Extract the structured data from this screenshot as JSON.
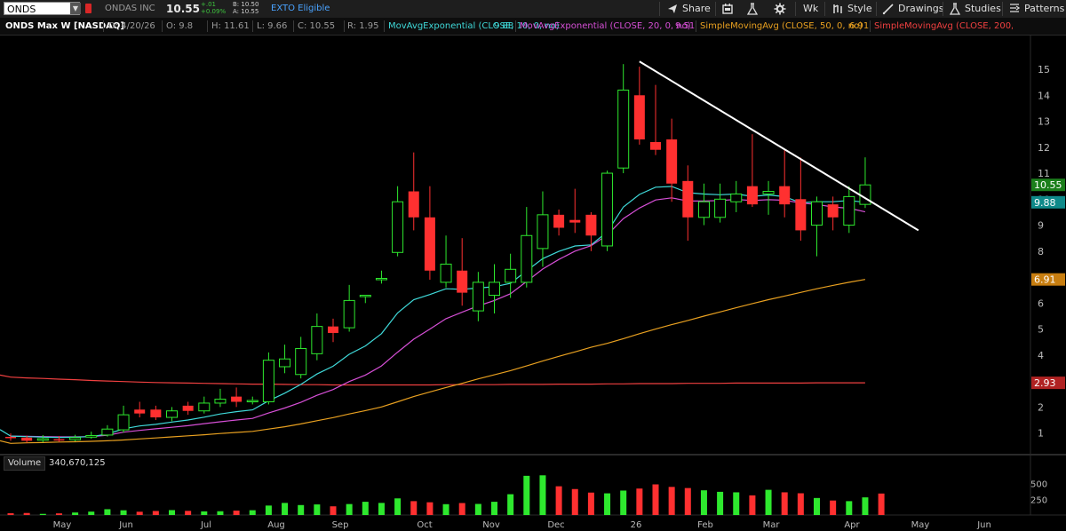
{
  "toolbar": {
    "symbol": "ONDS",
    "company": "ONDAS INC",
    "last": "10.55",
    "change_abs": "+.01",
    "change_pct": "+0.09%",
    "bid": "B: 10.50",
    "ask": "A: 10.55",
    "exto": "EXTO Eligible",
    "share": "Share",
    "period": "Wk",
    "style": "Style",
    "drawings": "Drawings",
    "studies": "Studies",
    "patterns": "Patterns"
  },
  "header": {
    "title": "ONDS Max W [NASDAQ]",
    "date": "D: 4/20/26",
    "open": "O: 9.8",
    "high": "H: 11.61",
    "low": "L: 9.66",
    "close": "C: 10.55",
    "range": "R: 1.95",
    "studies": [
      {
        "label": "MovAvgExponential (CLOSE, 10, 0, no)",
        "value": "9.88",
        "color": "#3fd9d9"
      },
      {
        "label": "MovAvgExponential (CLOSE, 20, 0, no)",
        "value": "9.51",
        "color": "#d64fd6"
      },
      {
        "label": "SimpleMovingAvg (CLOSE, 50, 0, no)",
        "value": "6.91",
        "color": "#e8a020"
      },
      {
        "label": "SimpleMovingAvg (CLOSE, 200, 0,...",
        "value": "",
        "color": "#f04040"
      }
    ]
  },
  "volume": {
    "label": "Volume",
    "value": "340,670,125"
  },
  "price_tags": [
    {
      "text": "10.55",
      "value": 10.55,
      "bg": "#1b7f1b"
    },
    {
      "text": "9.88",
      "value": 9.88,
      "bg": "#0f8a8a"
    },
    {
      "text": "6.91",
      "value": 6.91,
      "bg": "#c87e10"
    },
    {
      "text": "2.93",
      "value": 2.93,
      "bg": "#b02222"
    }
  ],
  "chart_data": {
    "type": "candlestick",
    "price_range": [
      0.2,
      16.3
    ],
    "y_ticks": [
      "1",
      "2",
      "3",
      "4",
      "5",
      "6",
      "7",
      "8",
      "9",
      "10",
      "11",
      "12",
      "13",
      "14",
      "15"
    ],
    "x_labels": [
      "May",
      "Jun",
      "Jul",
      "Aug",
      "Sep",
      "Oct",
      "Nov",
      "Dec",
      "26",
      "Feb",
      "Mar",
      "Apr",
      "May",
      "Jun"
    ],
    "volume_ticks": [
      "250",
      "500"
    ],
    "colors": {
      "up": "#2ee82e",
      "down": "#ff3030",
      "trendline": "#ffffff"
    },
    "candles": [
      [
        0.85,
        0.82,
        0.98,
        0.7
      ],
      [
        0.82,
        0.7,
        0.9,
        0.62
      ],
      [
        0.72,
        0.78,
        0.92,
        0.64
      ],
      [
        0.76,
        0.72,
        0.88,
        0.65
      ],
      [
        0.74,
        0.82,
        0.93,
        0.68
      ],
      [
        0.84,
        0.9,
        1.05,
        0.78
      ],
      [
        0.92,
        1.15,
        1.3,
        0.86
      ],
      [
        1.12,
        1.7,
        2.05,
        1.02
      ],
      [
        1.9,
        1.75,
        2.2,
        1.6
      ],
      [
        1.9,
        1.6,
        2.05,
        1.5
      ],
      [
        1.6,
        1.85,
        2.0,
        1.45
      ],
      [
        2.05,
        1.85,
        2.2,
        1.7
      ],
      [
        1.85,
        2.15,
        2.4,
        1.75
      ],
      [
        2.15,
        2.3,
        2.7,
        2.0
      ],
      [
        2.4,
        2.2,
        2.75,
        2.0
      ],
      [
        2.25,
        2.25,
        2.4,
        2.1
      ],
      [
        2.2,
        3.8,
        4.1,
        2.1
      ],
      [
        3.55,
        3.85,
        4.4,
        3.3
      ],
      [
        3.25,
        4.25,
        4.7,
        3.1
      ],
      [
        4.05,
        5.1,
        5.6,
        3.8
      ],
      [
        5.1,
        4.85,
        5.4,
        4.5
      ],
      [
        5.05,
        6.1,
        6.7,
        4.9
      ],
      [
        6.25,
        6.3,
        6.3,
        6.0
      ],
      [
        6.95,
        6.95,
        7.25,
        6.75
      ],
      [
        7.95,
        9.9,
        10.5,
        7.8
      ],
      [
        10.3,
        9.3,
        11.8,
        8.8
      ],
      [
        9.3,
        7.25,
        10.5,
        6.9
      ],
      [
        6.8,
        7.5,
        8.6,
        6.6
      ],
      [
        7.25,
        6.4,
        8.5,
        5.9
      ],
      [
        5.7,
        6.8,
        7.2,
        5.3
      ],
      [
        6.3,
        6.8,
        7.5,
        5.6
      ],
      [
        6.8,
        7.3,
        7.9,
        6.2
      ],
      [
        6.8,
        8.6,
        9.7,
        6.6
      ],
      [
        8.1,
        9.4,
        10.3,
        7.4
      ],
      [
        9.4,
        8.9,
        9.6,
        8.6
      ],
      [
        9.2,
        9.1,
        10.4,
        8.7
      ],
      [
        9.4,
        8.6,
        9.5,
        8.0
      ],
      [
        8.2,
        11.0,
        11.1,
        8.0
      ],
      [
        11.2,
        14.2,
        15.2,
        11.0
      ],
      [
        14.0,
        12.3,
        15.1,
        12.1
      ],
      [
        12.2,
        11.9,
        14.4,
        11.7
      ],
      [
        12.3,
        10.6,
        13.1,
        9.9
      ],
      [
        10.7,
        9.3,
        11.3,
        8.4
      ],
      [
        9.3,
        9.9,
        10.6,
        9.0
      ],
      [
        9.3,
        10.0,
        10.6,
        9.1
      ],
      [
        9.9,
        10.2,
        10.7,
        9.5
      ],
      [
        10.5,
        9.8,
        12.5,
        9.7
      ],
      [
        10.2,
        10.3,
        10.7,
        9.4
      ],
      [
        10.5,
        9.8,
        11.9,
        9.3
      ],
      [
        10.0,
        8.8,
        11.6,
        8.4
      ],
      [
        9.0,
        9.9,
        10.1,
        7.8
      ],
      [
        9.8,
        9.3,
        10.1,
        8.8
      ],
      [
        9.0,
        10.1,
        10.5,
        8.7
      ],
      [
        9.8,
        10.55,
        11.61,
        9.66
      ]
    ],
    "volumes": [
      28,
      32,
      18,
      26,
      40,
      54,
      92,
      75,
      52,
      64,
      78,
      66,
      58,
      60,
      70,
      76,
      150,
      192,
      158,
      168,
      138,
      174,
      210,
      192,
      264,
      220,
      202,
      172,
      190,
      176,
      210,
      330,
      622,
      630,
      456,
      412,
      356,
      344,
      388,
      420,
      486,
      446,
      428,
      392,
      368,
      360,
      312,
      400,
      360,
      345,
      270,
      230,
      220,
      280,
      341
    ],
    "ema10": [
      0.88,
      0.86,
      0.84,
      0.83,
      0.84,
      0.86,
      0.96,
      1.16,
      1.27,
      1.33,
      1.42,
      1.5,
      1.61,
      1.73,
      1.82,
      1.89,
      2.24,
      2.53,
      2.87,
      3.27,
      3.57,
      4.03,
      4.35,
      4.82,
      5.62,
      6.13,
      6.33,
      6.55,
      6.53,
      6.58,
      6.63,
      6.76,
      7.24,
      7.71,
      7.99,
      8.2,
      8.24,
      8.74,
      9.7,
      10.18,
      10.46,
      10.49,
      10.25,
      10.2,
      10.17,
      10.2,
      10.11,
      10.16,
      10.1,
      9.86,
      9.9,
      9.9,
      9.95,
      9.88
    ],
    "ema20": [
      0.88,
      0.87,
      0.86,
      0.85,
      0.85,
      0.86,
      0.91,
      1.03,
      1.1,
      1.16,
      1.22,
      1.28,
      1.36,
      1.43,
      1.5,
      1.56,
      1.77,
      1.96,
      2.18,
      2.45,
      2.67,
      2.98,
      3.23,
      3.58,
      4.11,
      4.61,
      5.0,
      5.4,
      5.65,
      5.89,
      6.1,
      6.36,
      6.83,
      7.31,
      7.68,
      8.0,
      8.21,
      8.62,
      9.25,
      9.66,
      9.97,
      10.05,
      9.93,
      9.93,
      9.95,
      9.99,
      9.95,
      9.98,
      9.96,
      9.85,
      9.8,
      9.7,
      9.65,
      9.51
    ],
    "sma50": [
      0.6,
      0.62,
      0.63,
      0.65,
      0.66,
      0.68,
      0.7,
      0.73,
      0.77,
      0.81,
      0.85,
      0.89,
      0.93,
      0.98,
      1.02,
      1.06,
      1.15,
      1.24,
      1.35,
      1.47,
      1.59,
      1.73,
      1.86,
      2.0,
      2.2,
      2.4,
      2.58,
      2.75,
      2.91,
      3.08,
      3.24,
      3.4,
      3.58,
      3.77,
      3.95,
      4.12,
      4.3,
      4.45,
      4.63,
      4.82,
      5.0,
      5.17,
      5.33,
      5.5,
      5.66,
      5.82,
      5.98,
      6.13,
      6.27,
      6.41,
      6.55,
      6.68,
      6.8,
      6.91
    ],
    "sma200": [
      3.15,
      3.12,
      3.1,
      3.07,
      3.05,
      3.02,
      3.0,
      2.98,
      2.96,
      2.94,
      2.93,
      2.92,
      2.91,
      2.9,
      2.89,
      2.88,
      2.88,
      2.87,
      2.86,
      2.86,
      2.85,
      2.85,
      2.85,
      2.85,
      2.85,
      2.85,
      2.85,
      2.86,
      2.86,
      2.86,
      2.86,
      2.87,
      2.87,
      2.87,
      2.88,
      2.88,
      2.88,
      2.89,
      2.89,
      2.9,
      2.9,
      2.9,
      2.91,
      2.91,
      2.91,
      2.92,
      2.92,
      2.92,
      2.92,
      2.92,
      2.93,
      2.93,
      2.93,
      2.93
    ],
    "trendline": [
      [
        39,
        15.3
      ],
      [
        56.3,
        8.8
      ]
    ]
  }
}
